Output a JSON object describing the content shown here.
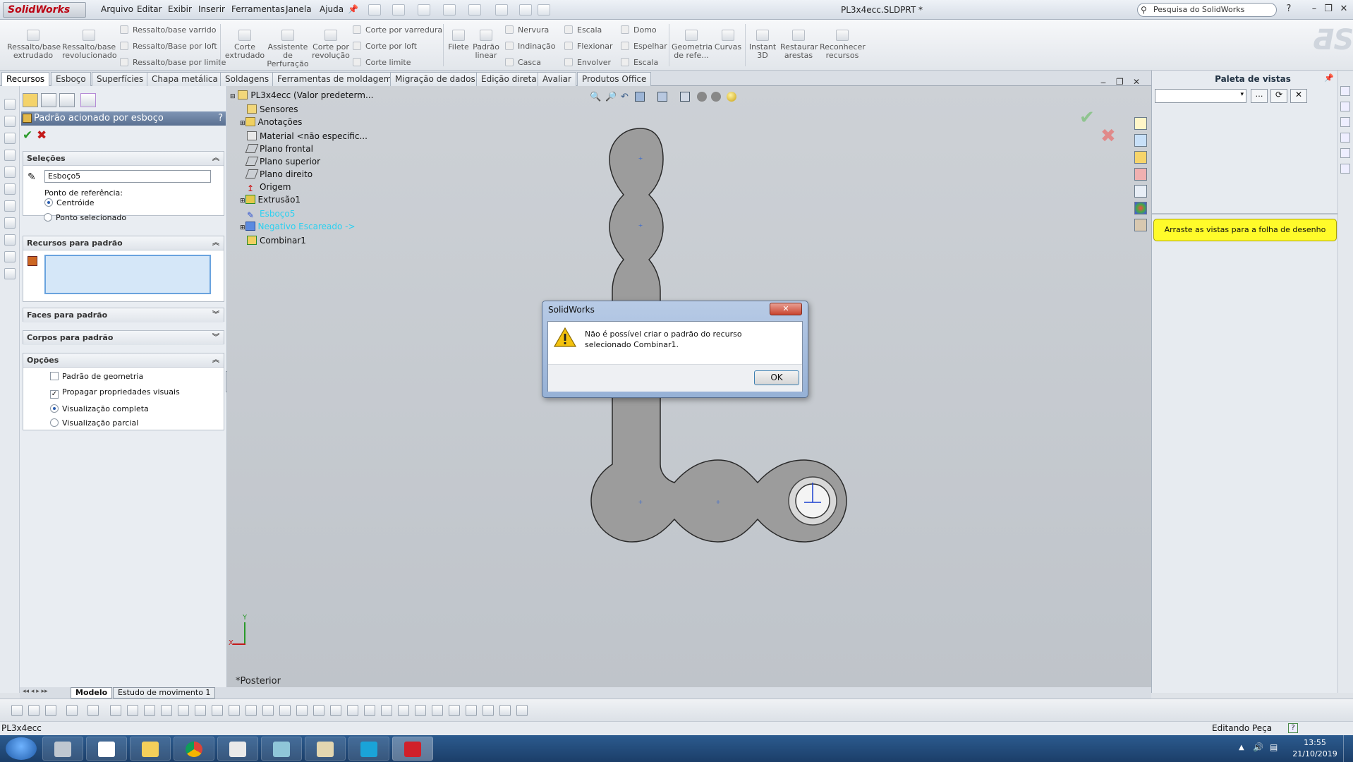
{
  "app": {
    "logo": "SolidWorks",
    "doc_title": "PL3x4ecc.SLDPRT *"
  },
  "menu": [
    "Arquivo",
    "Editar",
    "Exibir",
    "Inserir",
    "Ferramentas",
    "Janela",
    "Ajuda"
  ],
  "search": {
    "placeholder": "Pesquisa do SolidWorks"
  },
  "ribbon": {
    "big": [
      {
        "label": "Ressalto/base extrudado"
      },
      {
        "label": "Ressalto/base revolucionado"
      },
      {
        "label": "Corte extrudado"
      },
      {
        "label": "Assistente de Perfuração"
      },
      {
        "label": "Corte por revolução"
      },
      {
        "label": "Filete"
      },
      {
        "label": "Padrão linear"
      },
      {
        "label": "Geometria de refe..."
      },
      {
        "label": "Curvas"
      },
      {
        "label": "Instant 3D"
      },
      {
        "label": "Restaurar arestas"
      },
      {
        "label": "Reconhecer recursos"
      }
    ],
    "small1": [
      "Ressalto/base varrido",
      "Ressalto/Base por loft",
      "Ressalto/base por limite"
    ],
    "small2": [
      "Corte por varredura",
      "Corte por loft",
      "Corte limite"
    ],
    "small3": [
      "Nervura",
      "Indinação",
      "Casca"
    ],
    "small4": [
      "Escala",
      "Flexionar",
      "Envolver"
    ],
    "small5": [
      "Domo",
      "Espelhar",
      "Escala"
    ]
  },
  "tabs": [
    "Recursos",
    "Esboço",
    "Superfícies",
    "Chapa metálica",
    "Soldagens",
    "Ferramentas de moldagem",
    "Migração de dados",
    "Edição direta",
    "Avaliar",
    "Produtos Office"
  ],
  "pm": {
    "title": "Padrão acionado por esboço",
    "help": "?",
    "selections": {
      "header": "Seleções",
      "sketch_value": "Esboço5",
      "ref_label": "Ponto de referência:",
      "opt1": "Centróide",
      "opt2": "Ponto selecionado"
    },
    "features": {
      "header": "Recursos para padrão"
    },
    "faces": {
      "header": "Faces para padrão"
    },
    "bodies": {
      "header": "Corpos para padrão"
    },
    "options": {
      "header": "Opções",
      "o1": "Padrão de geometria",
      "o2": "Propagar propriedades visuais",
      "o3": "Visualização completa",
      "o4": "Visualização parcial"
    }
  },
  "tree": [
    {
      "label": "PL3x4ecc  (Valor predeterm..."
    },
    {
      "label": "Sensores"
    },
    {
      "label": "Anotações"
    },
    {
      "label": "Material <não especific..."
    },
    {
      "label": "Plano frontal"
    },
    {
      "label": "Plano superior"
    },
    {
      "label": "Plano direito"
    },
    {
      "label": "Origem"
    },
    {
      "label": "Extrusão1"
    },
    {
      "label": "Esboço5"
    },
    {
      "label": "Negativo Escareado ->"
    },
    {
      "label": "Combinar1"
    }
  ],
  "view": {
    "orientation": "*Posterior",
    "axis_y": "Y",
    "axis_x": "X"
  },
  "dialog": {
    "title": "SolidWorks",
    "message": "Não é possível criar o padrão do recurso selecionado Combinar1.",
    "ok": "OK",
    "close": "✕"
  },
  "right_panel": {
    "title": "Paleta de vistas",
    "hint": "Arraste as vistas para a folha de desenho"
  },
  "model_tabs": [
    "Modelo",
    "Estudo de movimento 1"
  ],
  "status": {
    "left": "PL3x4ecc",
    "right": "Editando Peça"
  },
  "taskbar": {
    "time": "13:55",
    "date": "21/10/2019"
  },
  "colors": {
    "accent": "#5a7091",
    "dialog_frame": "#96b1d6",
    "hint_bg": "#fffb2a",
    "taskbar": "#1b3e69"
  }
}
